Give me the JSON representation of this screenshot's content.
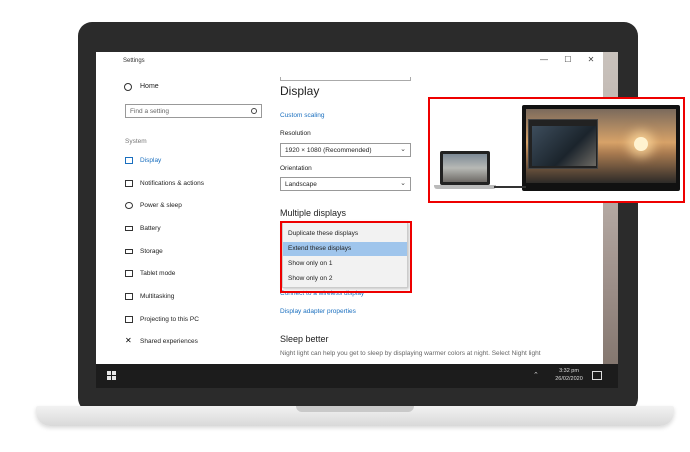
{
  "window": {
    "title": "Settings",
    "minimize": "—",
    "maximize": "☐",
    "close": "✕"
  },
  "sidebar": {
    "home": "Home",
    "search_placeholder": "Find a setting",
    "section": "System",
    "items": [
      {
        "label": "Display",
        "icon": "monitor-icon",
        "active": true
      },
      {
        "label": "Notifications & actions",
        "icon": "notification-icon",
        "active": false
      },
      {
        "label": "Power & sleep",
        "icon": "power-icon",
        "active": false
      },
      {
        "label": "Battery",
        "icon": "battery-icon",
        "active": false
      },
      {
        "label": "Storage",
        "icon": "storage-icon",
        "active": false
      },
      {
        "label": "Tablet mode",
        "icon": "tablet-icon",
        "active": false
      },
      {
        "label": "Multitasking",
        "icon": "multitasking-icon",
        "active": false
      },
      {
        "label": "Projecting to this PC",
        "icon": "projecting-icon",
        "active": false
      },
      {
        "label": "Shared experiences",
        "icon": "shared-icon",
        "active": false
      }
    ]
  },
  "content": {
    "title": "Display",
    "custom_scaling": "Custom scaling",
    "resolution_label": "Resolution",
    "resolution_value": "1920 × 1080 (Recommended)",
    "orientation_label": "Orientation",
    "orientation_value": "Landscape",
    "multiple_displays_heading": "Multiple displays",
    "multiple_displays_options": [
      {
        "label": "Duplicate these displays",
        "selected": false
      },
      {
        "label": "Extend these displays",
        "selected": true
      },
      {
        "label": "Show only on 1",
        "selected": false
      },
      {
        "label": "Show only on 2",
        "selected": false
      }
    ],
    "wireless_link": "Connect to a wireless display",
    "adapter_link": "Display adapter properties",
    "sleep_heading": "Sleep better",
    "sleep_text": "Night light can help you get to sleep by displaying warmer colors at night. Select Night light"
  },
  "taskbar": {
    "time": "3:32 pm",
    "date": "26/02/2020"
  },
  "colors": {
    "accent": "#1a6fbf",
    "highlight_border": "#e00000",
    "selected_option": "#9fc5ec"
  }
}
